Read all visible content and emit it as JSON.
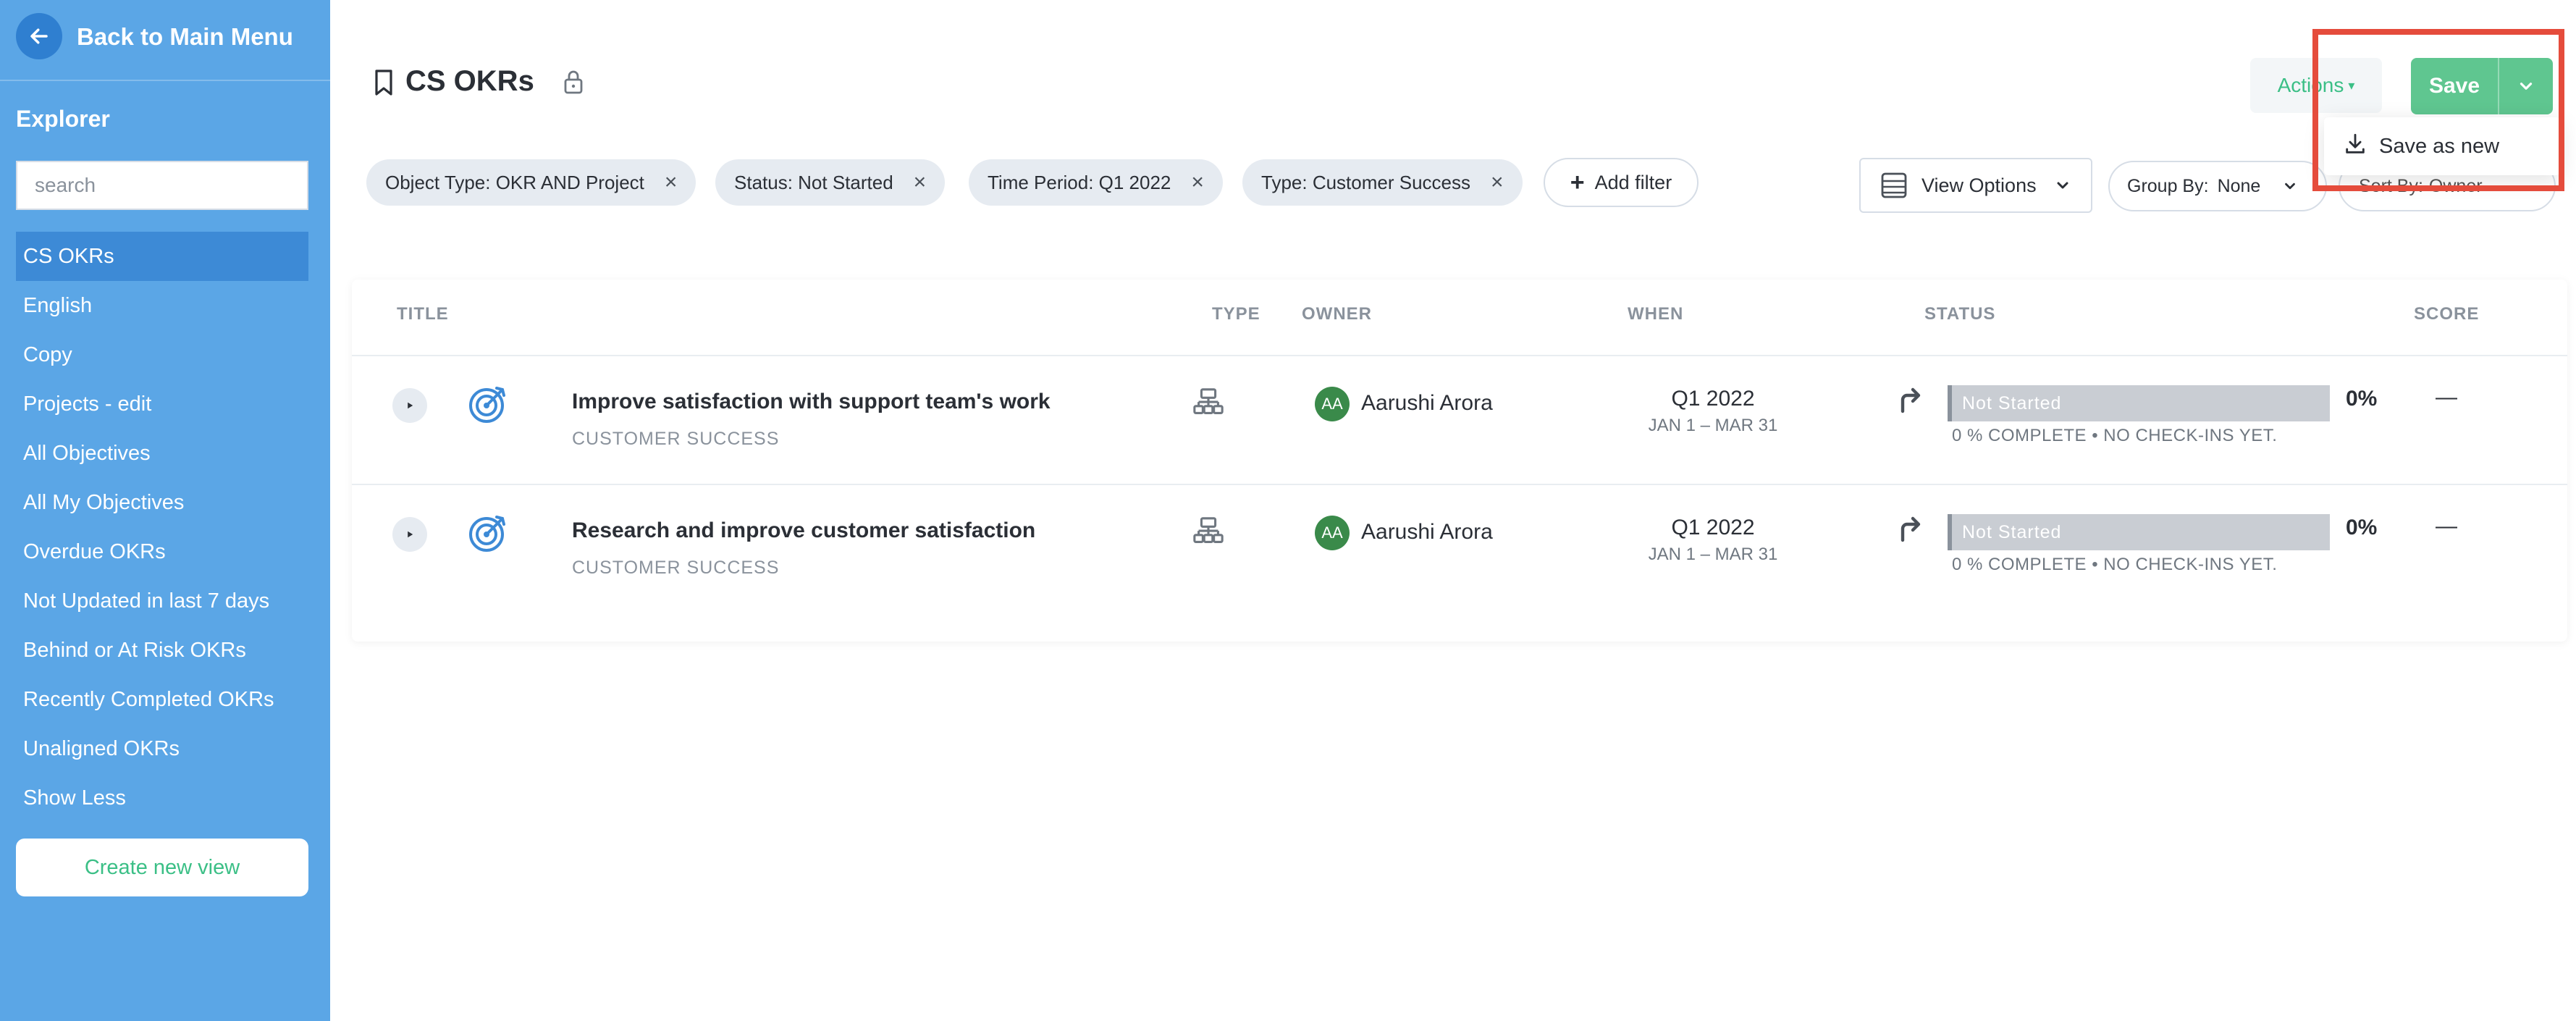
{
  "sidebar": {
    "back_label": "Back to Main Menu",
    "heading": "Explorer",
    "search_placeholder": "search",
    "items": [
      {
        "label": "CS OKRs",
        "active": true
      },
      {
        "label": "English"
      },
      {
        "label": "Copy"
      },
      {
        "label": "Projects - edit"
      },
      {
        "label": "All Objectives"
      },
      {
        "label": "All My Objectives"
      },
      {
        "label": "Overdue OKRs"
      },
      {
        "label": "Not Updated in last 7 days"
      },
      {
        "label": "Behind or At Risk OKRs"
      },
      {
        "label": "Recently Completed OKRs"
      },
      {
        "label": "Unaligned OKRs"
      },
      {
        "label": "Show Less"
      }
    ],
    "create_label": "Create new view"
  },
  "header": {
    "title": "CS OKRs",
    "actions_label": "Actions",
    "save_label": "Save",
    "dropdown": {
      "save_as_new": "Save as new"
    }
  },
  "filters": {
    "chips": [
      "Object Type: OKR AND Project",
      "Status: Not Started",
      "Time Period: Q1 2022",
      "Type: Customer Success"
    ],
    "add_filter": "Add filter",
    "view_options": "View Options",
    "group_by_label": "Group By:",
    "group_by_value": "None",
    "sort_by_label": "Sort By:",
    "sort_by_value": "Owner"
  },
  "table": {
    "columns": {
      "title": "TITLE",
      "type": "TYPE",
      "owner": "OWNER",
      "when": "WHEN",
      "status": "STATUS",
      "score": "SCORE"
    },
    "rows": [
      {
        "title": "Improve satisfaction with support team's work",
        "category": "CUSTOMER SUCCESS",
        "owner_initials": "AA",
        "owner": "Aarushi Arora",
        "quarter": "Q1 2022",
        "dates": "JAN 1 – MAR 31",
        "status": "Not Started",
        "percent": "0%",
        "progress_text": "0  % COMPLETE • NO CHECK-INS YET.",
        "score": "—"
      },
      {
        "title": "Research and improve customer satisfaction",
        "category": "CUSTOMER SUCCESS",
        "owner_initials": "AA",
        "owner": "Aarushi Arora",
        "quarter": "Q1 2022",
        "dates": "JAN 1 – MAR 31",
        "status": "Not Started",
        "percent": "0%",
        "progress_text": "0  % COMPLETE • NO CHECK-INS YET.",
        "score": "—"
      }
    ]
  },
  "colors": {
    "sidebar_bg": "#5ba6e6",
    "accent_green": "#5fc690",
    "highlight_red": "#e54c3c",
    "icon_blue": "#3d8ad6"
  }
}
